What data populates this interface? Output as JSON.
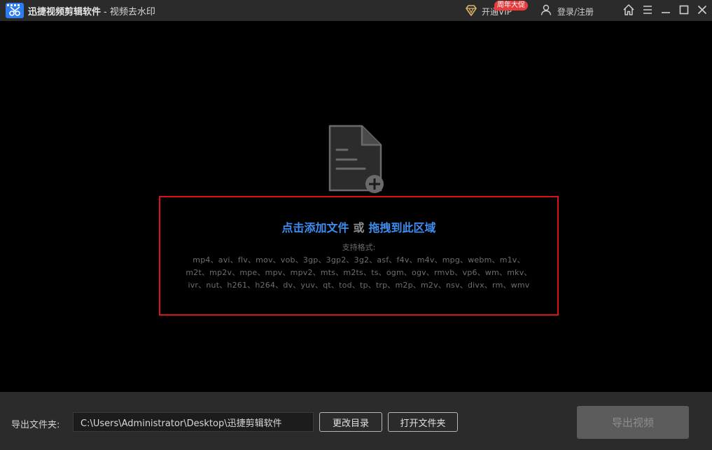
{
  "app": {
    "title": "迅捷视频剪辑软件",
    "subtitle": "- 视频去水印"
  },
  "header": {
    "vip_label": "开通VIP",
    "vip_badge": "周年大促",
    "login_label": "登录/注册"
  },
  "icons": {
    "logo": "scissors-film-logo-icon",
    "vip": "diamond-icon",
    "user": "user-icon",
    "home": "home-icon",
    "menu": "menu-icon",
    "minimize": "minimize-icon",
    "maximize": "maximize-icon",
    "close": "close-icon",
    "add_file": "add-file-icon"
  },
  "drop_area": {
    "add_text": "点击添加文件",
    "or_text": "或",
    "drag_text": "拖拽到此区域",
    "formats_title": "支持格式:",
    "formats_lines": [
      "mp4、avi、flv、mov、vob、3gp、3gp2、3g2、asf、f4v、m4v、mpg、webm、m1v、",
      "m2t、mp2v、mpe、mpv、mpv2、mts、m2ts、ts、ogm、ogv、rmvb、vp6、wm、mkv、",
      "ivr、nut、h261、h264、dv、yuv、qt、tod、tp、trp、m2p、m2v、nsv、divx、rm、wmv"
    ]
  },
  "footer": {
    "export_folder_label": "导出文件夹:",
    "export_path": "C:\\Users\\Administrator\\Desktop\\迅捷剪辑软件",
    "change_dir_label": "更改目录",
    "open_folder_label": "打开文件夹",
    "export_video_label": "导出视频"
  },
  "colors": {
    "accent_blue": "#3d8ef0",
    "drop_border": "#d8141a",
    "badge_red": "#e83b3b",
    "vip_gold": "#d9b46a"
  }
}
